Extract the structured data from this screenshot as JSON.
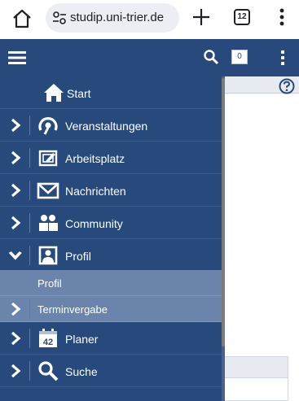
{
  "browser": {
    "url": "studip.uni-trier.de",
    "tab_count": "12",
    "icons": {
      "home": "home-icon",
      "site_settings": "tune-icon",
      "new_tab": "plus-icon",
      "more": "more-vert-icon"
    }
  },
  "header": {
    "notification_count": "0",
    "icons": {
      "menu": "hamburger-icon",
      "search": "search-icon",
      "more": "more-vert-icon"
    },
    "color": "#28497c"
  },
  "nav": {
    "start": "Start",
    "items": [
      {
        "label": "Veranstaltungen",
        "icon": "seminar-icon",
        "expanded": false
      },
      {
        "label": "Arbeitsplatz",
        "icon": "workplace-icon",
        "expanded": false
      },
      {
        "label": "Nachrichten",
        "icon": "mail-icon",
        "expanded": false
      },
      {
        "label": "Community",
        "icon": "community-icon",
        "expanded": false
      },
      {
        "label": "Profil",
        "icon": "person-icon",
        "expanded": true
      },
      {
        "label": "Planer",
        "icon": "calendar-icon",
        "expanded": false
      },
      {
        "label": "Suche",
        "icon": "search-icon",
        "expanded": false
      }
    ],
    "sub_items": [
      {
        "label": "Profil"
      },
      {
        "label": "Terminvergabe"
      }
    ],
    "calendar_day": "42"
  },
  "page": {
    "help_icon": "help-icon"
  }
}
